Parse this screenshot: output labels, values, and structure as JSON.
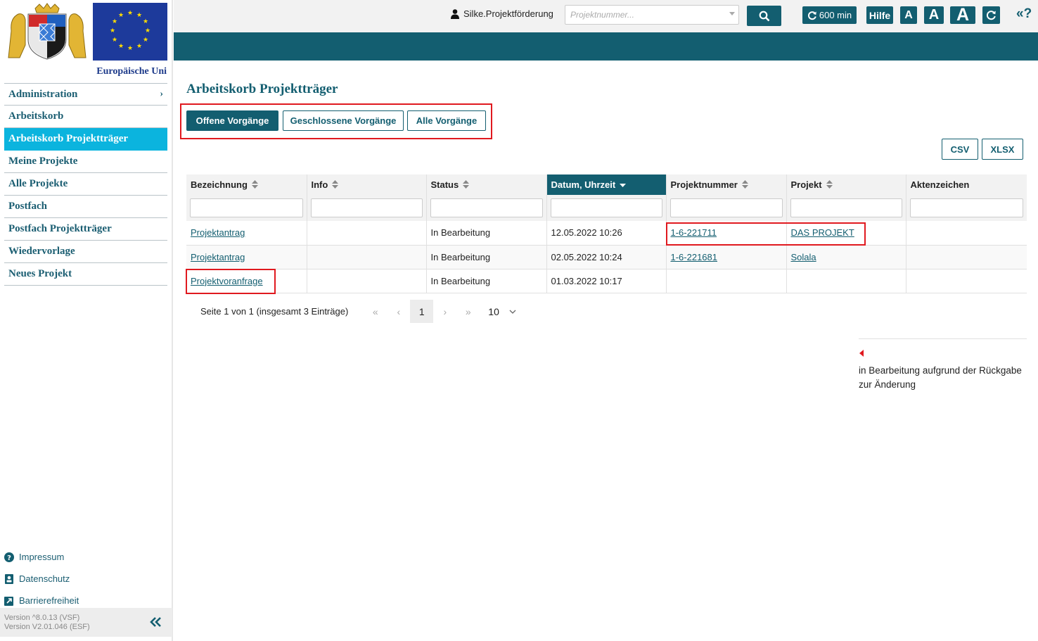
{
  "sidebar": {
    "eu_text": "Europäische Uni",
    "nav": [
      {
        "label": "Administration",
        "has_submenu": true
      },
      {
        "label": "Arbeitskorb"
      },
      {
        "label": "Arbeitskorb Projektträger",
        "active": true
      },
      {
        "label": "Meine Projekte"
      },
      {
        "label": "Alle Projekte"
      },
      {
        "label": "Postfach"
      },
      {
        "label": "Postfach Projektträger"
      },
      {
        "label": "Wiedervorlage"
      },
      {
        "label": "Neues Projekt"
      }
    ],
    "footer_links": [
      {
        "label": "Impressum",
        "icon": "question-circle-icon"
      },
      {
        "label": "Datenschutz",
        "icon": "id-card-icon"
      },
      {
        "label": "Barrierefreiheit",
        "icon": "external-link-icon"
      }
    ],
    "version_lines": [
      "Version ^8.0.13 (VSF)",
      "Version V2.01.046 (ESF)"
    ]
  },
  "header": {
    "user": "Silke.Projektförderung",
    "search_placeholder": "Projektnummer...",
    "session_time": "600 min",
    "help": "Hilfe",
    "font_sizes": [
      "A",
      "A",
      "A"
    ],
    "help_toggle": "«?"
  },
  "main": {
    "title": "Arbeitskorb Projektträger",
    "filters": [
      {
        "label": "Offene Vorgänge",
        "active": true
      },
      {
        "label": "Geschlossene Vorgänge"
      },
      {
        "label": "Alle Vorgänge"
      }
    ],
    "exports": [
      "CSV",
      "XLSX"
    ],
    "table": {
      "columns": [
        {
          "label": "Bezeichnung",
          "sortable": true
        },
        {
          "label": "Info",
          "sortable": true
        },
        {
          "label": "Status",
          "sortable": true
        },
        {
          "label": "Datum, Uhrzeit",
          "sortable": true,
          "sorted": "desc"
        },
        {
          "label": "Projektnummer",
          "sortable": true
        },
        {
          "label": "Projekt",
          "sortable": true
        },
        {
          "label": "Aktenzeichen",
          "sortable": false
        }
      ],
      "rows": [
        {
          "bezeichnung": "Projektantrag",
          "info": "",
          "status": "In Bearbeitung",
          "datum": "12.05.2022 10:26",
          "projektnummer": "1-6-221711",
          "projekt": "DAS PROJEKT",
          "aktenzeichen": ""
        },
        {
          "bezeichnung": "Projektantrag",
          "info": "",
          "status": "In Bearbeitung",
          "datum": "02.05.2022 10:24",
          "projektnummer": "1-6-221681",
          "projekt": "Solala",
          "aktenzeichen": ""
        },
        {
          "bezeichnung": "Projektvoranfrage",
          "info": "",
          "status": "In Bearbeitung",
          "datum": "01.03.2022 10:17",
          "projektnummer": "",
          "projekt": "",
          "aktenzeichen": ""
        }
      ]
    },
    "pager": {
      "info": "Seite 1 von 1 (insgesamt 3 Einträge)",
      "first": "«",
      "prev": "‹",
      "current_page": "1",
      "next": "›",
      "last": "»",
      "page_size": "10"
    },
    "legend": {
      "text": "in Bearbeitung aufgrund der Rückgabe zur Änderung",
      "marker_color": "#e0191f"
    }
  },
  "colors": {
    "primary": "#135e70",
    "active_nav": "#0bb4de",
    "highlight_red": "#e0191f"
  }
}
